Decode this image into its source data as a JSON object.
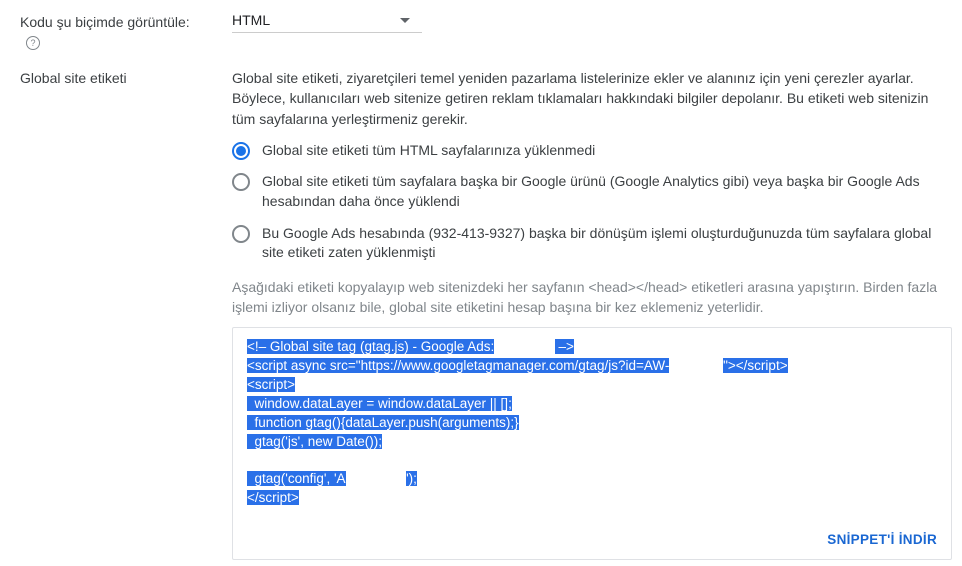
{
  "format_row": {
    "label": "Kodu şu biçimde görüntüle:",
    "selected": "HTML"
  },
  "global_tag": {
    "label": "Global site etiketi",
    "description": "Global site etiketi, ziyaretçileri temel yeniden pazarlama listelerinize ekler ve alanınız için yeni çerezler ayarlar. Böylece, kullanıcıları web sitenize getiren reklam tıklamaları hakkındaki bilgiler depolanır. Bu etiketi web sitenizin tüm sayfalarına yerleştirmeniz gerekir.",
    "options": [
      "Global site etiketi tüm HTML sayfalarınıza yüklenmedi",
      "Global site etiketi tüm sayfalara başka bir Google ürünü (Google Analytics gibi) veya başka bir Google Ads hesabından daha önce yüklendi",
      "Bu Google Ads hesabında (932-413-9327) başka bir dönüşüm işlemi oluşturduğunuzda tüm sayfalara global site etiketi zaten yüklenmişti"
    ],
    "selected_index": 0,
    "hint": "Aşağıdaki etiketi kopyalayıp web sitenizdeki her sayfanın <head></head> etiketleri arasına yapıştırın. Birden fazla işlemi izliyor olsanız bile, global site etiketini hesap başına bir kez eklemeniz yeterlidir.",
    "code": {
      "l1a": "<!– Global site tag (gtag.js) - Google Ads:",
      "l1b": " –>",
      "l2a": "<script async src=\"https://www.googletagmanager.com/gtag/js?id=AW-",
      "l2b": "\"></script>",
      "l3": "<script>",
      "l4": "  window.dataLayer = window.dataLayer || [];",
      "l5": "  function gtag(){dataLayer.push(arguments);}",
      "l6": "  gtag('js', new Date());",
      "l7a": "  gtag('config', 'A",
      "l7b": "');",
      "l8": "</script>"
    },
    "download_label": "SNİPPET'İ İNDİR"
  }
}
